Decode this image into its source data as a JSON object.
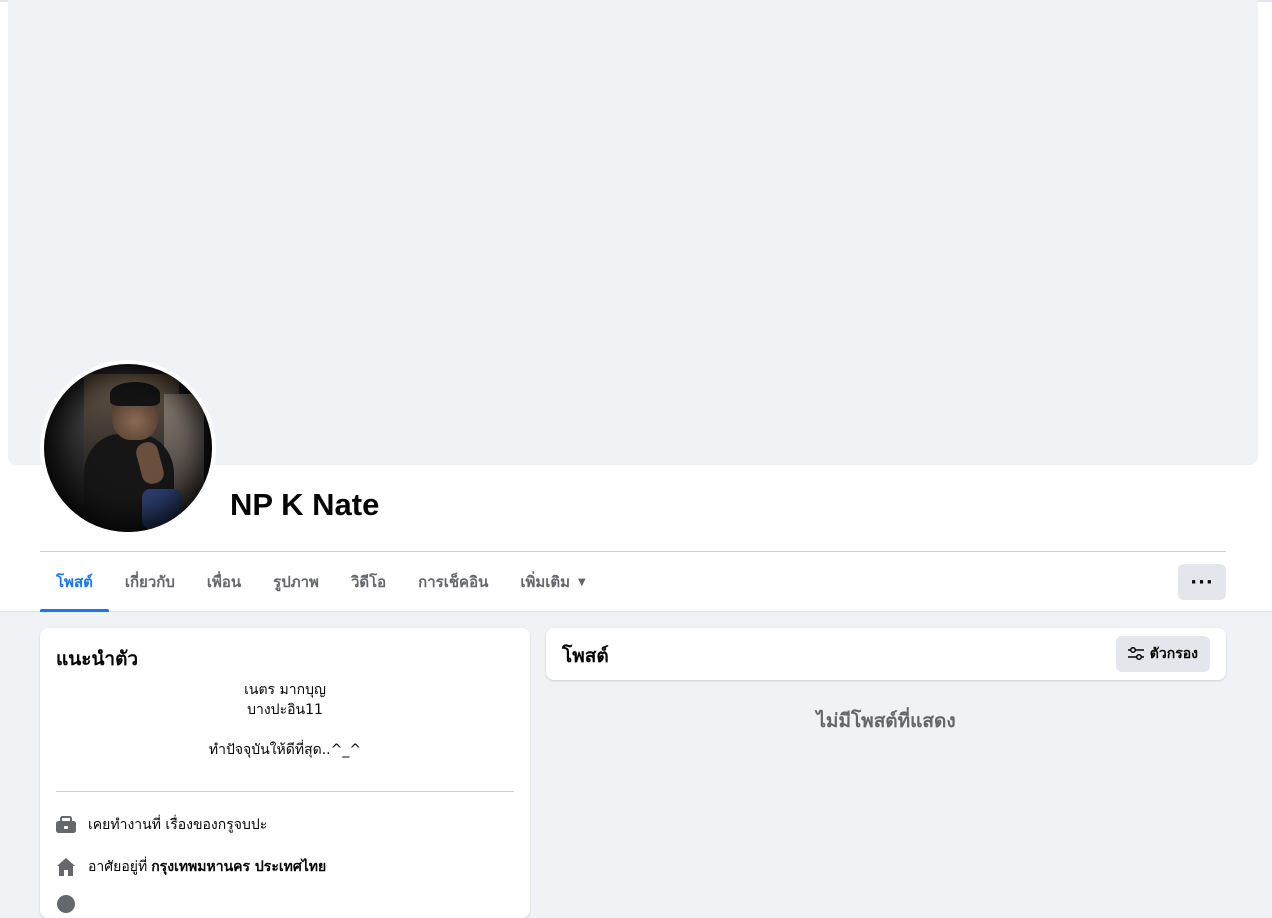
{
  "profile": {
    "name": "NP K Nate"
  },
  "tabs": [
    {
      "label": "โพสต์",
      "active": true
    },
    {
      "label": "เกี่ยวกับ",
      "active": false
    },
    {
      "label": "เพื่อน",
      "active": false
    },
    {
      "label": "รูปภาพ",
      "active": false
    },
    {
      "label": "วิดีโอ",
      "active": false
    },
    {
      "label": "การเช็คอิน",
      "active": false
    },
    {
      "label": "เพิ่มเติม",
      "active": false
    }
  ],
  "more_button": {
    "label": "···"
  },
  "intro": {
    "title": "แนะนำตัว",
    "bio_lines": [
      "เนตร มากบุญ",
      "บางปะอิน11",
      "",
      "ทำปัจจุบันให้ดีที่สุด..^_^"
    ],
    "work": {
      "prefix": "เคยทำงานที่",
      "value": "เรื่องของกรูจบปะ",
      "icon": "briefcase-icon"
    },
    "home": {
      "prefix": "อาศัยอยู่ที่",
      "value": "กรุงเทพมหานคร ประเทศไทย",
      "icon": "home-icon"
    }
  },
  "posts": {
    "title": "โพสต์",
    "filter_label": "ตัวกรอง",
    "empty_message": "ไม่มีโพสต์ที่แสดง"
  },
  "colors": {
    "accent": "#1877f2",
    "background": "#f0f2f5",
    "secondary_text": "#65676b",
    "button_bg": "#e4e6eb"
  }
}
